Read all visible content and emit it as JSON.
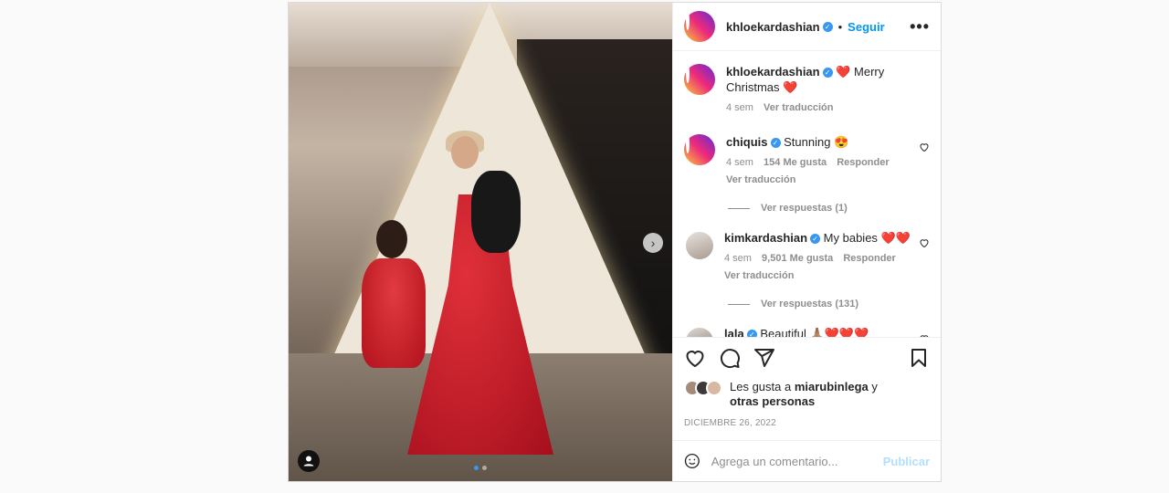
{
  "post": {
    "author": "khloekardashian",
    "follow_label": "Seguir",
    "more_label": "•••",
    "dot": "•",
    "next_arrow": "›",
    "caption": {
      "username": "khloekardashian",
      "text": "❤️ Merry Christmas ❤️",
      "time": "4 sem",
      "translate": "Ver traducción"
    },
    "comments": [
      {
        "username": "chiquis",
        "text": "Stunning 😍",
        "time": "4 sem",
        "likes": "154 Me gusta",
        "reply": "Responder",
        "translate": "Ver traducción",
        "replies": "Ver respuestas (1)"
      },
      {
        "username": "kimkardashian",
        "text": "My babies ❤️❤️",
        "time": "4 sem",
        "likes": "9,501 Me gusta",
        "reply": "Responder",
        "translate": "Ver traducción",
        "replies": "Ver respuestas (131)"
      },
      {
        "username": "lala",
        "text": "Beautiful 🙏🏽❤️❤️❤️"
      }
    ],
    "liked_by_prefix": "Les gusta a",
    "liked_by_user": "miarubinlega",
    "liked_by_suffix": "y",
    "liked_by_others": "otras personas",
    "date": "DICIEMBRE 26, 2022",
    "comment_placeholder": "Agrega un comentario...",
    "publish_label": "Publicar",
    "icons": [
      "heart-icon",
      "comment-icon",
      "share-icon",
      "bookmark-icon",
      "emoji-icon",
      "verified-icon",
      "chevron-right-icon",
      "user-tag-icon"
    ],
    "colors": {
      "link": "#0095f6",
      "verified": "#3897f0",
      "publish_disabled": "#b2dffc"
    }
  }
}
